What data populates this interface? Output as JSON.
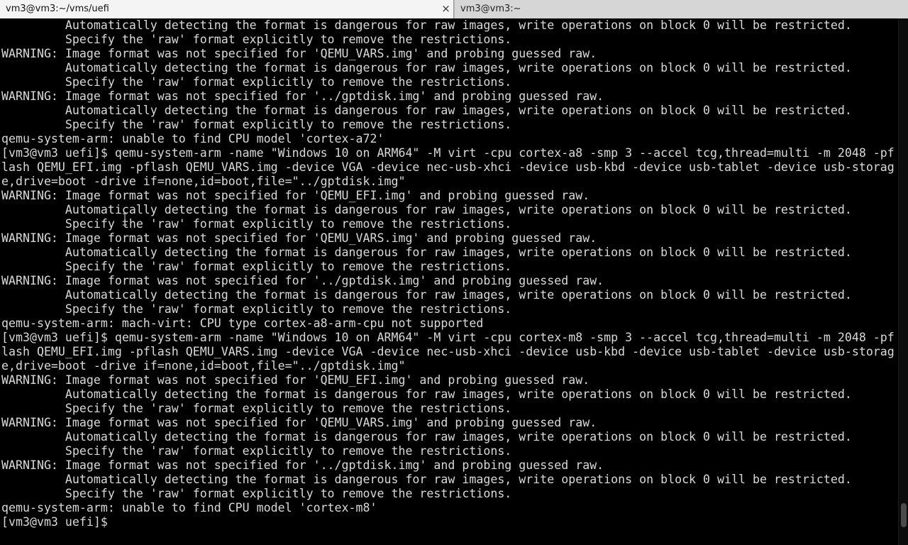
{
  "tabs": [
    {
      "label": "vm3@vm3:~/vms/uefi",
      "close": "×"
    },
    {
      "label": "vm3@vm3:~"
    }
  ],
  "scroll_position": 0.97,
  "terminal_lines": [
    "         Automatically detecting the format is dangerous for raw images, write operations on block 0 will be restricted.",
    "         Specify the 'raw' format explicitly to remove the restrictions.",
    "WARNING: Image format was not specified for 'QEMU_VARS.img' and probing guessed raw.",
    "         Automatically detecting the format is dangerous for raw images, write operations on block 0 will be restricted.",
    "         Specify the 'raw' format explicitly to remove the restrictions.",
    "WARNING: Image format was not specified for '../gptdisk.img' and probing guessed raw.",
    "         Automatically detecting the format is dangerous for raw images, write operations on block 0 will be restricted.",
    "         Specify the 'raw' format explicitly to remove the restrictions.",
    "qemu-system-arm: unable to find CPU model 'cortex-a72'",
    "[vm3@vm3 uefi]$ qemu-system-arm -name \"Windows 10 on ARM64\" -M virt -cpu cortex-a8 -smp 3 --accel tcg,thread=multi -m 2048 -pf",
    "lash QEMU_EFI.img -pflash QEMU_VARS.img -device VGA -device nec-usb-xhci -device usb-kbd -device usb-tablet -device usb-storag",
    "e,drive=boot -drive if=none,id=boot,file=\"../gptdisk.img\"",
    "WARNING: Image format was not specified for 'QEMU_EFI.img' and probing guessed raw.",
    "         Automatically detecting the format is dangerous for raw images, write operations on block 0 will be restricted.",
    "         Specify the 'raw' format explicitly to remove the restrictions.",
    "WARNING: Image format was not specified for 'QEMU_VARS.img' and probing guessed raw.",
    "         Automatically detecting the format is dangerous for raw images, write operations on block 0 will be restricted.",
    "         Specify the 'raw' format explicitly to remove the restrictions.",
    "WARNING: Image format was not specified for '../gptdisk.img' and probing guessed raw.",
    "         Automatically detecting the format is dangerous for raw images, write operations on block 0 will be restricted.",
    "         Specify the 'raw' format explicitly to remove the restrictions.",
    "qemu-system-arm: mach-virt: CPU type cortex-a8-arm-cpu not supported",
    "[vm3@vm3 uefi]$ qemu-system-arm -name \"Windows 10 on ARM64\" -M virt -cpu cortex-m8 -smp 3 --accel tcg,thread=multi -m 2048 -pf",
    "lash QEMU_EFI.img -pflash QEMU_VARS.img -device VGA -device nec-usb-xhci -device usb-kbd -device usb-tablet -device usb-storag",
    "e,drive=boot -drive if=none,id=boot,file=\"../gptdisk.img\"",
    "WARNING: Image format was not specified for 'QEMU_EFI.img' and probing guessed raw.",
    "         Automatically detecting the format is dangerous for raw images, write operations on block 0 will be restricted.",
    "         Specify the 'raw' format explicitly to remove the restrictions.",
    "WARNING: Image format was not specified for 'QEMU_VARS.img' and probing guessed raw.",
    "         Automatically detecting the format is dangerous for raw images, write operations on block 0 will be restricted.",
    "         Specify the 'raw' format explicitly to remove the restrictions.",
    "WARNING: Image format was not specified for '../gptdisk.img' and probing guessed raw.",
    "         Automatically detecting the format is dangerous for raw images, write operations on block 0 will be restricted.",
    "         Specify the 'raw' format explicitly to remove the restrictions.",
    "qemu-system-arm: unable to find CPU model 'cortex-m8'",
    "[vm3@vm3 uefi]$ "
  ]
}
